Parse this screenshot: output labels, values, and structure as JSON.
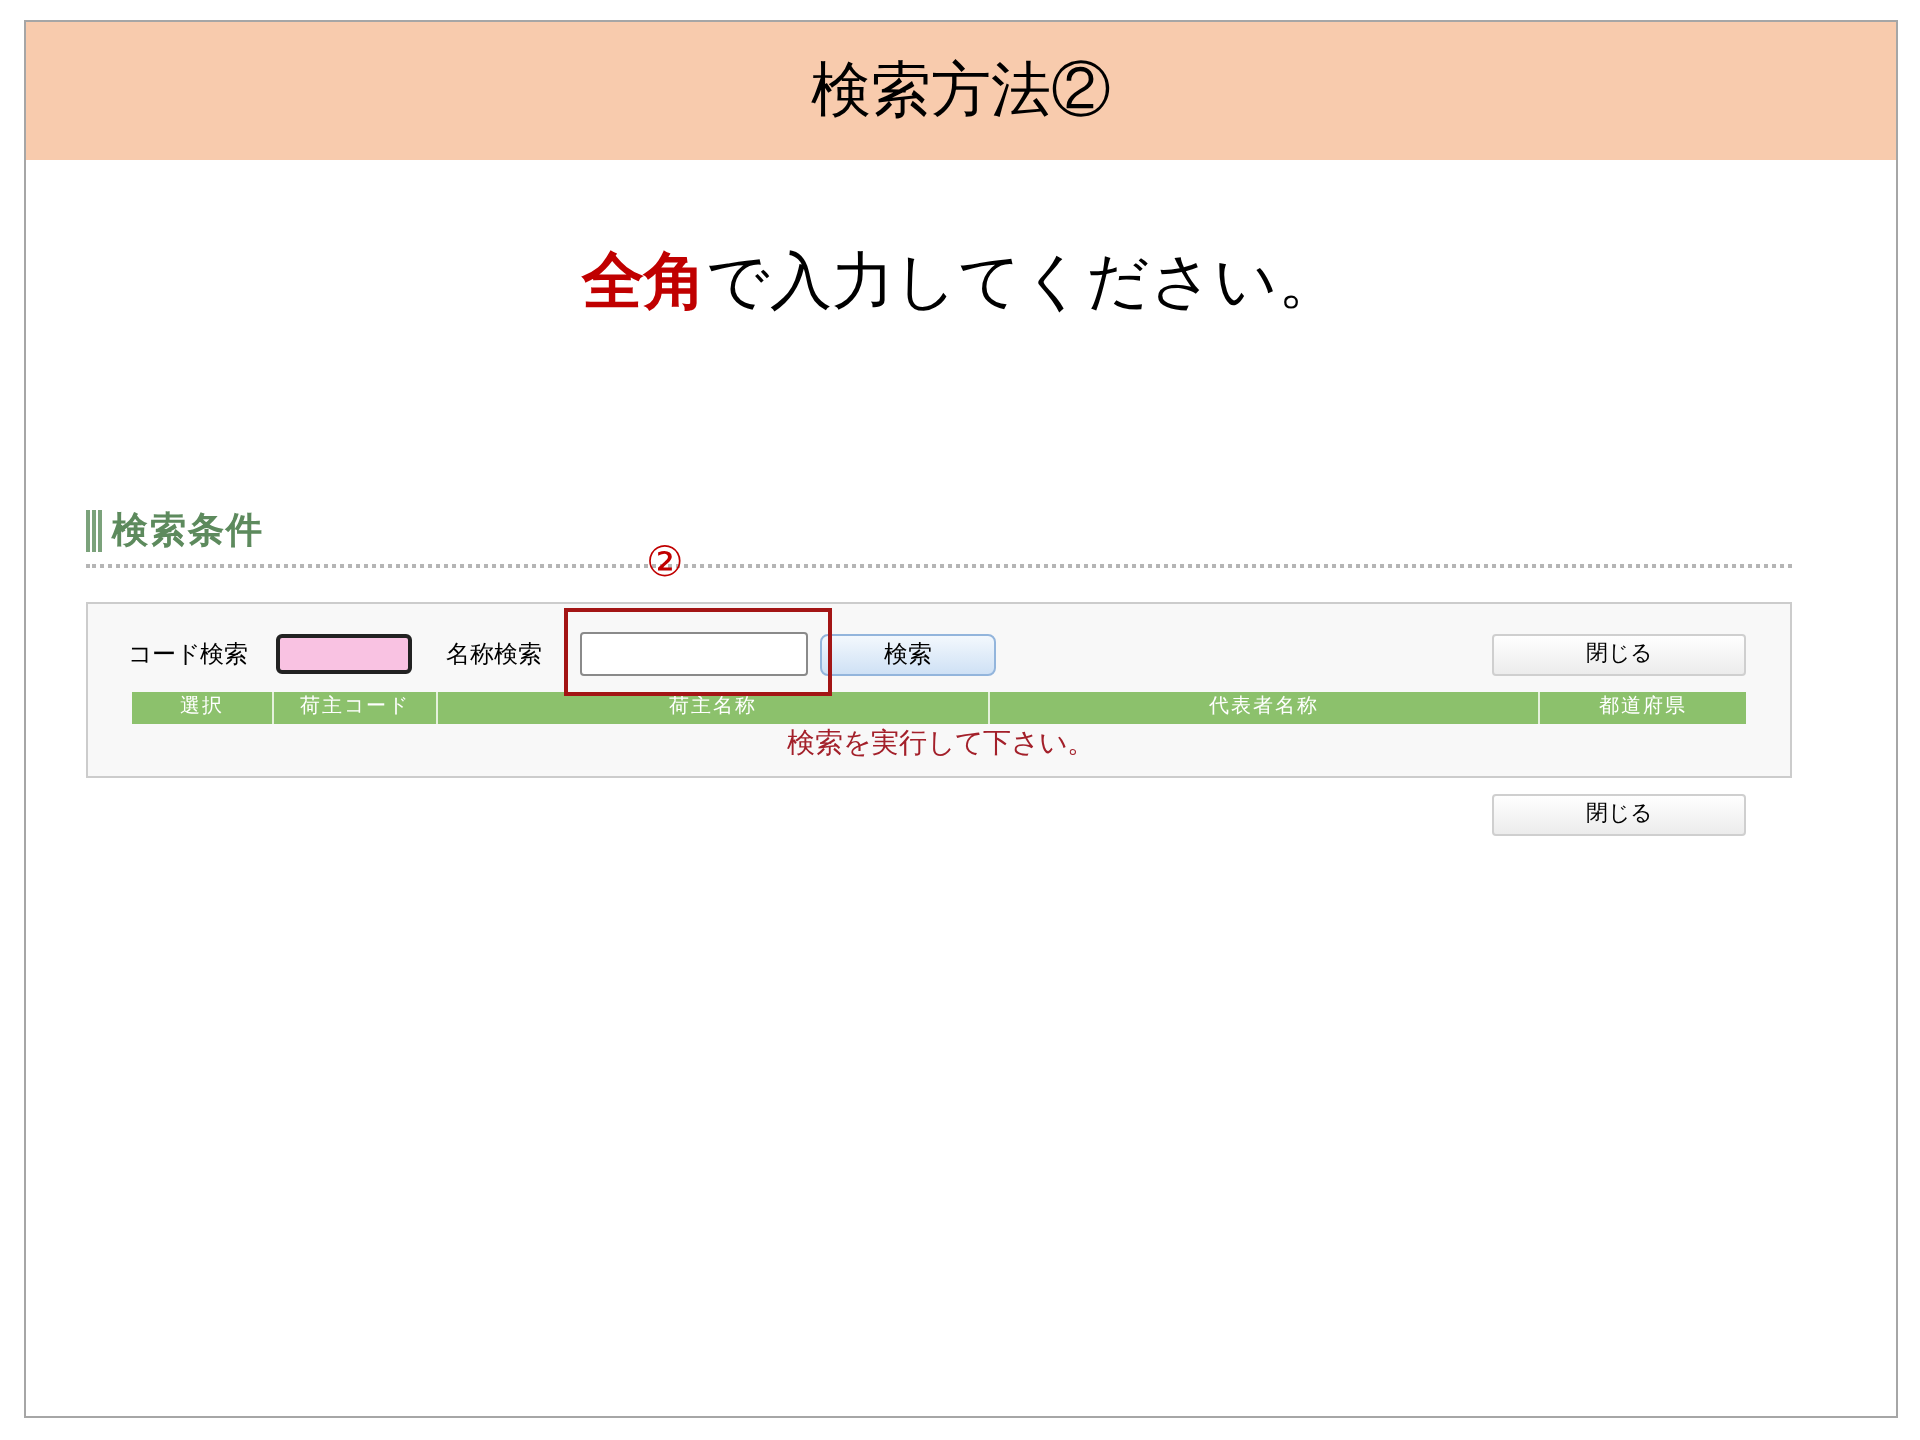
{
  "slide": {
    "title": "検索方法②",
    "instruction": "**全角**で入力してください。"
  },
  "screen": {
    "heading": "検索条件",
    "annotation": {
      "label": "②"
    },
    "search_bar": {
      "code_label": "コード検索",
      "code_field": {
        "highlighted": true
      },
      "name_label": "名称検索",
      "search_button": "検索",
      "close_button": "閉じる"
    },
    "table": {
      "columns": [
        "選択",
        "荷主コード",
        "荷主名称",
        "代表者名称",
        "都道府県"
      ],
      "message": "検索を実行して下さい。"
    },
    "footer_button": "閉じる"
  }
}
